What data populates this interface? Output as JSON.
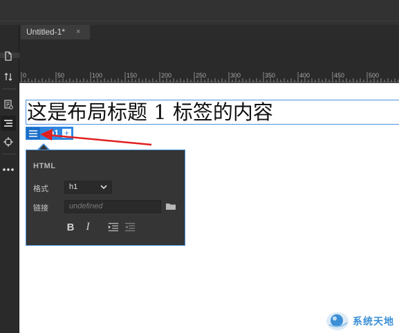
{
  "document": {
    "tab_title": "Untitled-1*",
    "close_glyph": "×"
  },
  "ruler": {
    "ticks": [
      "0",
      "50",
      "100",
      "150",
      "200",
      "250",
      "300",
      "350",
      "400",
      "450",
      "500"
    ]
  },
  "left_toolbar": {
    "icons": [
      "file-icon",
      "file-transfer-icon",
      "live-view-inspect-icon",
      "element-display-icon",
      "target-icon",
      "more-icon"
    ]
  },
  "canvas": {
    "heading_text": "这是布局标题 1 标签的内容",
    "element_tag": "h1",
    "add_glyph": "+"
  },
  "hud": {
    "title": "HTML",
    "format_label": "格式",
    "format_value": "h1",
    "link_label": "链接",
    "link_placeholder": "undefined",
    "bold_label": "B",
    "italic_label": "I"
  },
  "watermark": {
    "text": "系统天地"
  },
  "colors": {
    "selection_blue": "#2f87e0",
    "annotation_arrow": "#e02020",
    "panel_bg": "#353535"
  }
}
